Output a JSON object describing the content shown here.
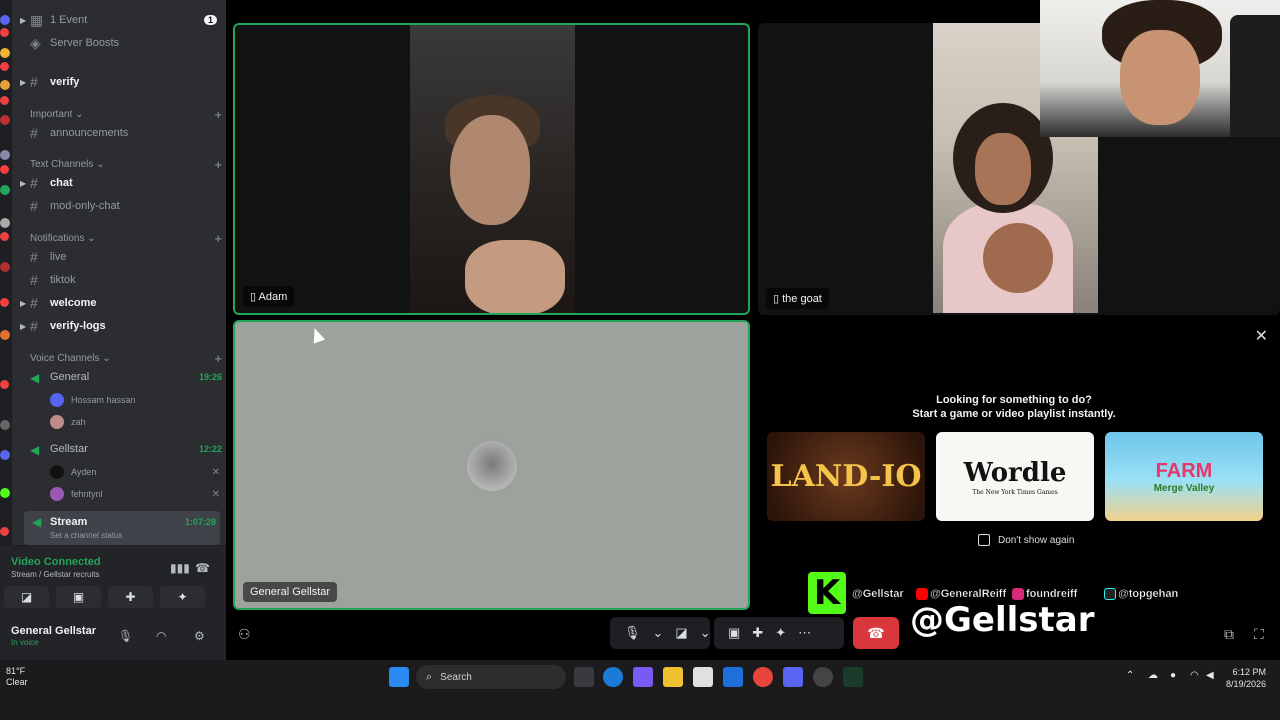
{
  "sidebar": {
    "top_items": [
      {
        "label": "1 Event",
        "badge": "1"
      },
      {
        "label": "Server Boosts"
      }
    ],
    "channels": {
      "verify": "verify",
      "important_cat": "Important",
      "announcements": "announcements",
      "text_cat": "Text Channels",
      "chat": "chat",
      "mod_only": "mod-only-chat",
      "notif_cat": "Notifications",
      "live": "live",
      "tiktok": "tiktok",
      "welcome": "welcome",
      "verify_logs": "verify-logs",
      "voice_cat": "Voice Channels"
    },
    "voice": {
      "general": {
        "name": "General",
        "time": "19:26",
        "users": [
          "Hossam hassan",
          "zah"
        ]
      },
      "gellstar": {
        "name": "Gellstar",
        "time": "12:22",
        "users": [
          "Ayden",
          "fehntynl"
        ]
      },
      "stream": {
        "name": "Stream",
        "time": "1:07:28",
        "status": "Set a channel status"
      }
    }
  },
  "voice_panel": {
    "title": "Video Connected",
    "subtitle": "Stream / Gellstar recruits",
    "username": "General Gellstar",
    "user_status": "In voice"
  },
  "stage": {
    "tiles": {
      "adam": "Adam",
      "goat": "the goat",
      "general": "General Gellstar"
    },
    "activity": {
      "title": "Looking for something to do?",
      "subtitle": "Start a game or video playlist instantly.",
      "games": {
        "land": "LAND-IO",
        "wordle": "Wordle",
        "wordle_sub": "The New York Times Games",
        "farm": "FARM",
        "farm_sub": "Merge Valley"
      },
      "dont_show": "Don't show again"
    }
  },
  "socials": {
    "kick": "@Gellstar",
    "youtube": "@GeneralReiff",
    "instagram": "foundreiff",
    "tiktok": "@topgehan",
    "big_handle": "@Gellstar",
    "kick_letter": "K"
  },
  "taskbar": {
    "temp": "81°F",
    "condition": "Clear",
    "search": "Search",
    "time": "6:12 PM",
    "date": "8/19/2026"
  },
  "colors": {
    "accent_green": "#23a559",
    "hangup_red": "#da373c",
    "kick_green": "#53fc18"
  }
}
